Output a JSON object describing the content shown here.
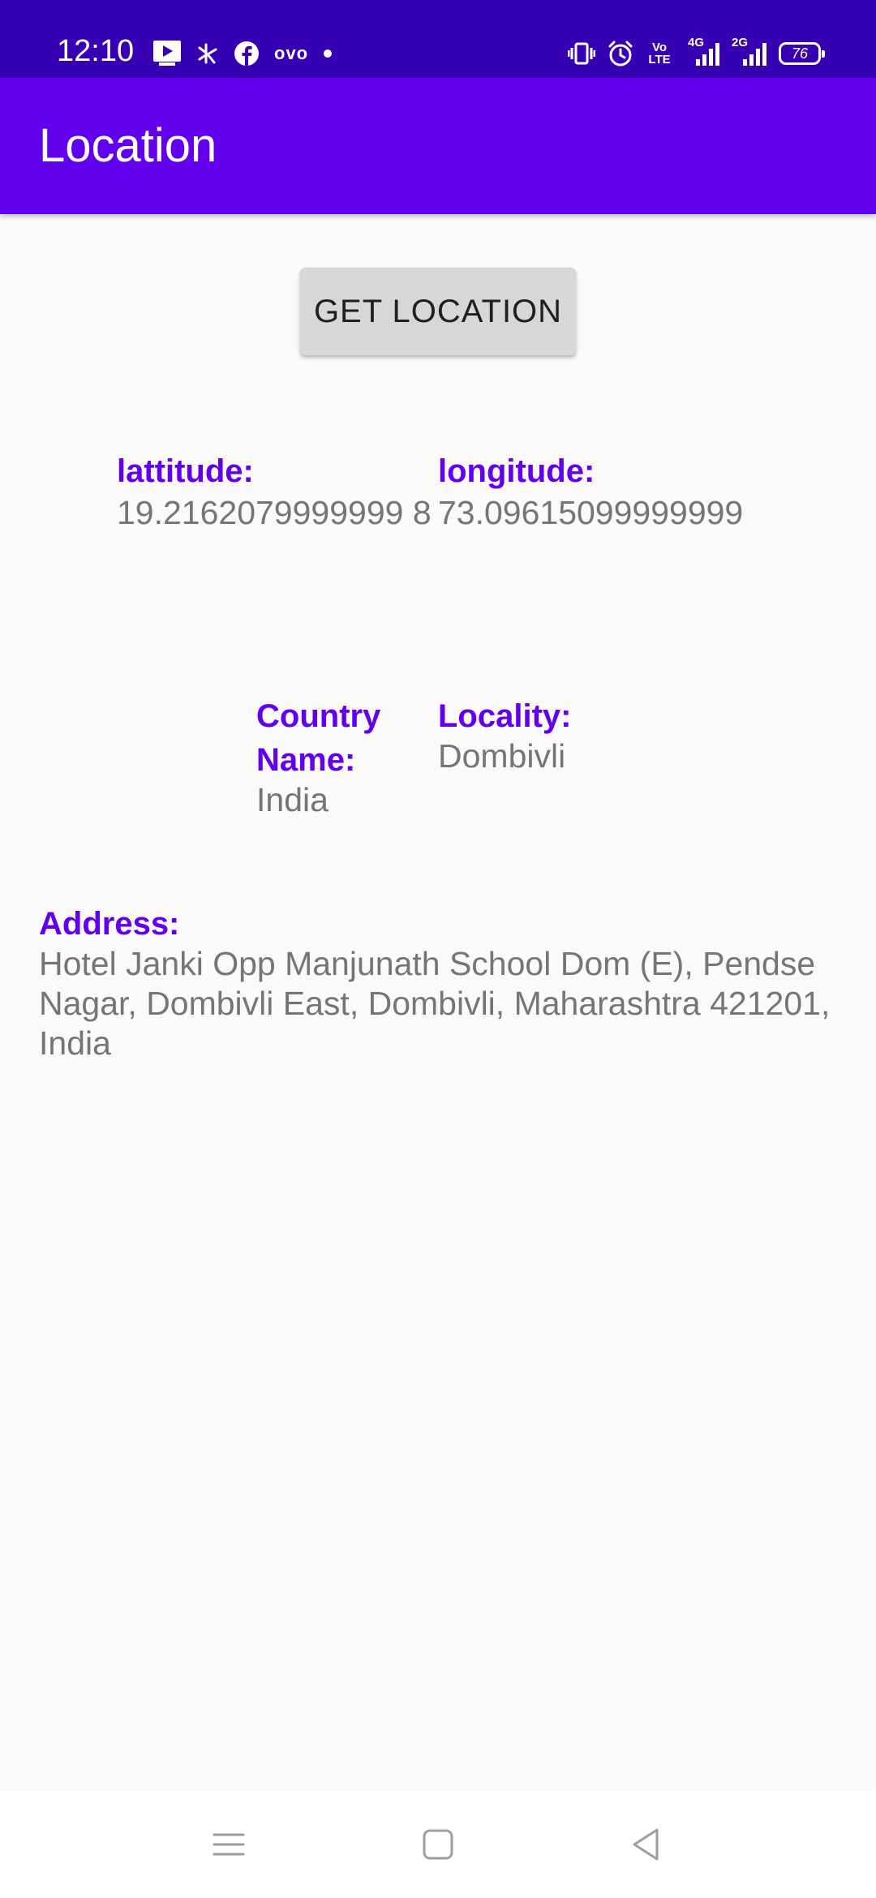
{
  "status_bar": {
    "time": "12:10",
    "battery_level": "76",
    "network_4g": "4G",
    "network_2g": "2G",
    "volte": "Vo LTE",
    "ovo": "ovo"
  },
  "app_bar": {
    "title": "Location"
  },
  "actions": {
    "get_location_label": "GET LOCATION"
  },
  "coordinates": {
    "latitude_label": "lattitude:",
    "latitude_value": "19.2162079999999 8",
    "longitude_label": "longitude:",
    "longitude_value": "73.09615099999999"
  },
  "place": {
    "country_label_line1": "Country",
    "country_label_line2": "Name:",
    "country_value": "India",
    "locality_label": "Locality:",
    "locality_value": "Dombivli"
  },
  "address": {
    "label": "Address:",
    "line1": "Hotel Janki Opp Manjunath School Dom (E), Pendse",
    "line2": "Nagar, Dombivli East, Dombivli, Maharashtra 421201,",
    "line3": "India"
  },
  "colors": {
    "status_bar": "#3700b3",
    "app_bar": "#6200ee",
    "label": "#6200ee",
    "value_text": "#757575",
    "button": "#d6d7d7"
  }
}
